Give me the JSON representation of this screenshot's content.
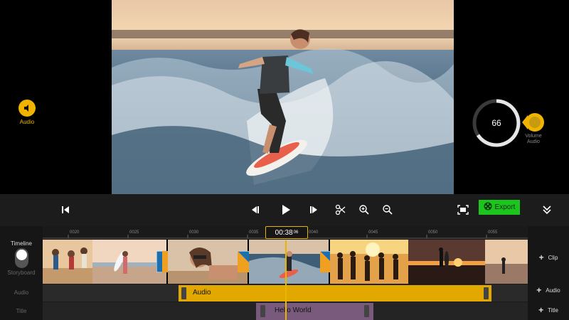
{
  "colors": {
    "accent": "#f0b400",
    "export": "#1ec41e",
    "audio_clip": "#e2a800",
    "title_clip": "#7a5a7c"
  },
  "preview": {
    "audio_label": "Audio",
    "volume": {
      "value": "66",
      "label_line1": "Volume",
      "label_line2": "Audio"
    }
  },
  "toolbar": {
    "icons": [
      "skip-to-start-icon",
      "previous-frame-icon",
      "play-icon",
      "next-frame-icon",
      "split-icon",
      "zoom-in-icon",
      "zoom-out-icon",
      "fit-screen-icon",
      "collapse-icon"
    ],
    "export_label": "Export"
  },
  "timeline": {
    "mode_label": "Timeline",
    "storyboard_label": "Storyboard",
    "tracks": {
      "audio": "Audio",
      "title": "Title"
    },
    "ruler_ticks": [
      "0020",
      "0025",
      "0030",
      "0035",
      "0040",
      "0045",
      "0050",
      "0055"
    ],
    "playhead": {
      "time": "00:38",
      "frames": "06"
    },
    "audio_clip_label": "Audio",
    "title_clip_label": "Hello World",
    "add_buttons": {
      "clip": "Clip",
      "audio": "Audio",
      "title": "Title"
    }
  }
}
